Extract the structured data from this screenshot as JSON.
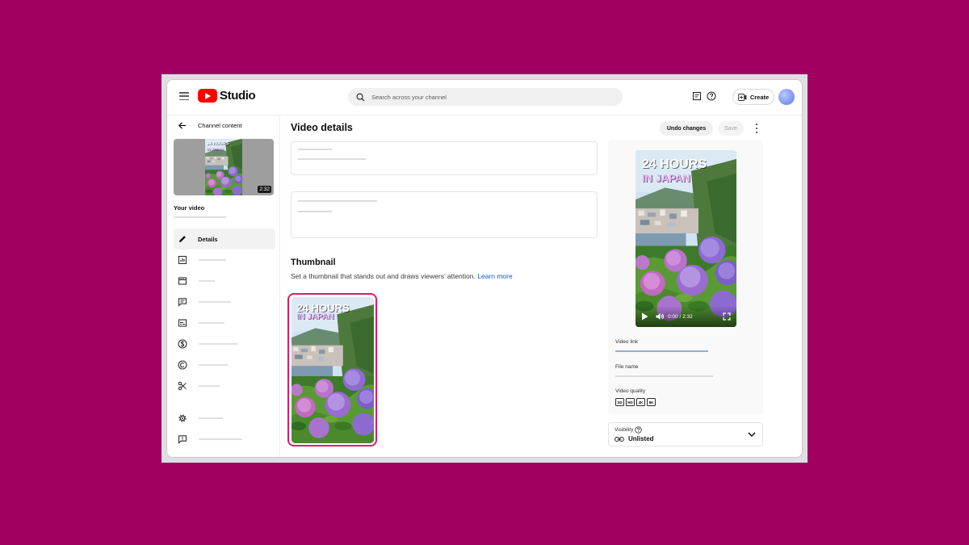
{
  "app": {
    "logo_text": "Studio"
  },
  "search": {
    "placeholder": "Search across your channel"
  },
  "header": {
    "create_label": "Create"
  },
  "sidebar": {
    "back_label": "Channel content",
    "video_duration": "2:32",
    "your_video_label": "Your video",
    "items": [
      {
        "label": "Details",
        "icon": "pencil-icon",
        "active": true
      }
    ]
  },
  "main": {
    "title": "Video details",
    "undo_label": "Undo changes",
    "save_label": "Save",
    "thumbnail": {
      "title": "Thumbnail",
      "description": "Set a thumbnail that stands out and draws viewers’ attention.",
      "learn_more": "Learn more"
    }
  },
  "video_overlay": {
    "line1": "24 HOURS",
    "line2": "IN JAPAN"
  },
  "player": {
    "time": "0:00 / 2:32"
  },
  "right_panel": {
    "video_link_label": "Video link",
    "file_name_label": "File name",
    "video_quality_label": "Video quality",
    "qualities": [
      "SD",
      "HD",
      "4K",
      "8K"
    ]
  },
  "visibility": {
    "label": "Visibility",
    "value": "Unlisted"
  },
  "colors": {
    "brand": "#ff0000",
    "highlight": "#de1b68",
    "link": "#065fd4",
    "background": "#a10060"
  }
}
